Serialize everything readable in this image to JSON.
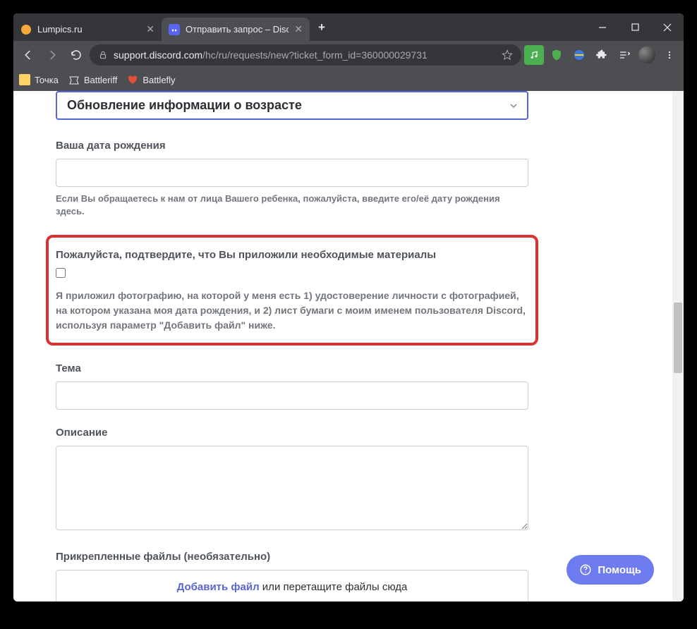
{
  "window": {
    "tabs": [
      {
        "title": "Lumpics.ru",
        "active": false
      },
      {
        "title": "Отправить запрос – Discord",
        "active": true
      }
    ]
  },
  "toolbar": {
    "url_domain": "support.discord.com",
    "url_path": "/hc/ru/requests/new?ticket_form_id=360000029731"
  },
  "bookmarks": [
    {
      "label": "Точка"
    },
    {
      "label": "Battleriff"
    },
    {
      "label": "Battlefly"
    }
  ],
  "form": {
    "dropdown_value": "Обновление информации о возрасте",
    "dob": {
      "label": "Ваша дата рождения",
      "value": "",
      "hint": "Если Вы обращаетесь к нам от лица Вашего ребенка, пожалуйста, введите его/её дату рождения здесь."
    },
    "confirm": {
      "label": "Пожалуйста, подтвердите, что Вы приложили необходимые материалы",
      "checked": false,
      "description": "Я приложил фотографию, на которой у меня есть 1) удостоверение личности с фотографией, на котором указана моя дата рождения, и 2) лист бумаги с моим именем пользователя Discord, используя параметр \"Добавить файл\" ниже."
    },
    "subject": {
      "label": "Тема",
      "value": ""
    },
    "description": {
      "label": "Описание",
      "value": ""
    },
    "attachments": {
      "label": "Прикрепленные файлы (необязательно)",
      "link_text": "Добавить файл",
      "suffix_text": " или перетащите файлы сюда"
    }
  },
  "help_button": "Помощь"
}
